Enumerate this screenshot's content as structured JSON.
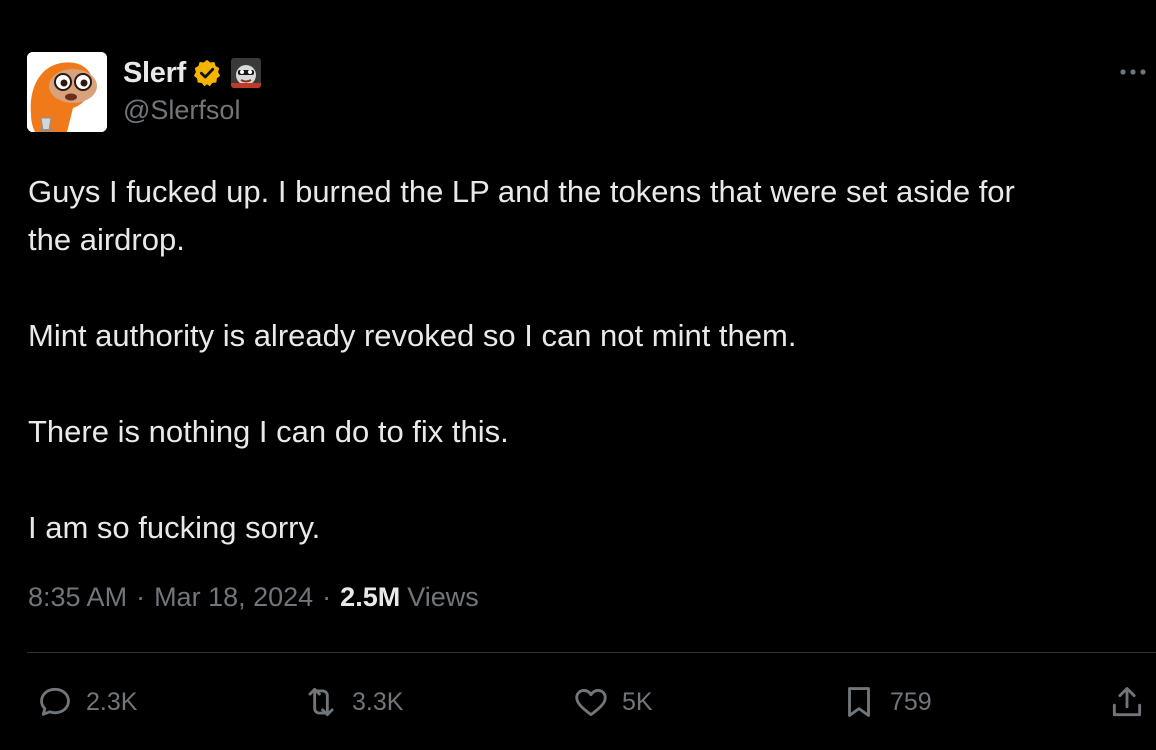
{
  "author": {
    "display_name": "Slerf",
    "handle": "@Slerfsol",
    "verified_icon": "verified-badge-icon",
    "affiliate_icon": "affiliate-badge-icon",
    "verified_color": "#f4b400"
  },
  "tweet": {
    "paragraphs": [
      "Guys I fucked up. I burned the LP and the tokens that were set aside for",
      "the airdrop.",
      "Mint authority is already revoked so I can not mint them.",
      "There is nothing I can do to fix this.",
      "I am so fucking sorry."
    ]
  },
  "meta": {
    "time": "8:35 AM",
    "separator": "·",
    "date": "Mar 18, 2024",
    "views_count": "2.5M",
    "views_label": "Views"
  },
  "actions": {
    "reply_count": "2.3K",
    "repost_count": "3.3K",
    "like_count": "5K",
    "bookmark_count": "759"
  },
  "colors": {
    "background": "#000000",
    "text": "#e7e9ea",
    "muted": "#71767b",
    "divider": "#2f3336",
    "avatar_orange": "#f07a1a"
  }
}
